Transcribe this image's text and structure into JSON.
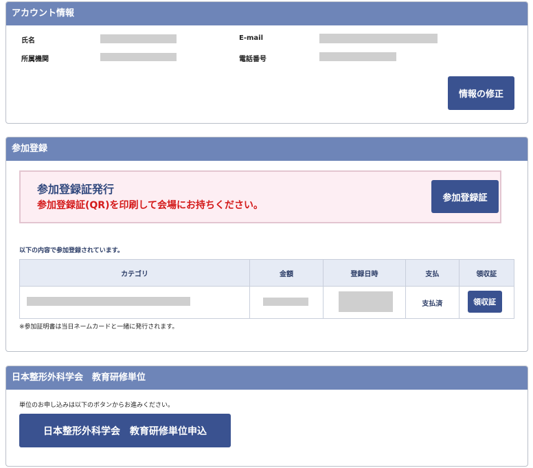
{
  "account": {
    "header": "アカウント情報",
    "name_label": "氏名",
    "email_label": "E-mail",
    "affiliation_label": "所属機関",
    "phone_label": "電話番号",
    "edit_button": "情報の修正"
  },
  "registration": {
    "header": "参加登録",
    "certificate_title": "参加登録証発行",
    "certificate_notice": "参加登録証(QR)を印刷して会場にお持ちください。",
    "certificate_button": "参加登録証",
    "registered_note": "以下の内容で参加登録されています。",
    "table": {
      "columns": [
        "カテゴリ",
        "金額",
        "登録日時",
        "支払",
        "領収証"
      ],
      "rows": [
        {
          "payment": "支払済",
          "receipt_button": "領収証"
        }
      ]
    },
    "footnote": "※参加証明書は当日ネームカードと一緒に発行されます。"
  },
  "credit": {
    "header": "日本整形外科学会　教育研修単位",
    "instruction": "単位のお申し込みは以下のボタンからお進みください。",
    "apply_button": "日本整形外科学会　教育研修単位申込"
  },
  "colors": {
    "header_bg": "#6e85b8",
    "button_bg": "#3a5290",
    "notice_red": "#d41a1a",
    "pink_bg": "#fdeef3",
    "table_header_bg": "#e6ebf5"
  }
}
